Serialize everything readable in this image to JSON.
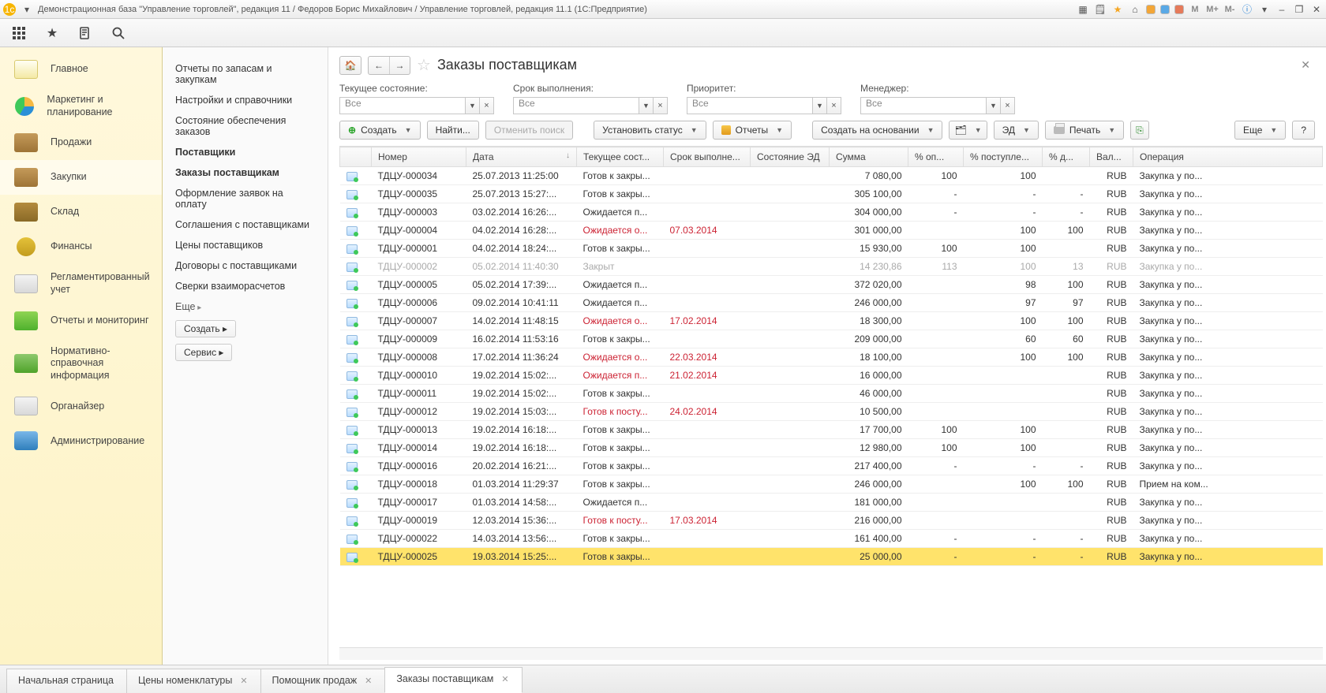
{
  "window_title": "Демонстрационная база \"Управление торговлей\", редакция 11 / Федоров Борис Михайлович / Управление торговлей, редакция 11.1  (1С:Предприятие)",
  "sidebar": [
    {
      "label": "Главное",
      "icon": "pi-main"
    },
    {
      "label": "Маркетинг и планирование",
      "icon": "pi-pie",
      "twoline": true
    },
    {
      "label": "Продажи",
      "icon": "pi-box"
    },
    {
      "label": "Закупки",
      "icon": "pi-cart",
      "active": true
    },
    {
      "label": "Склад",
      "icon": "pi-shelf"
    },
    {
      "label": "Финансы",
      "icon": "pi-coin"
    },
    {
      "label": "Регламентированный учет",
      "icon": "pi-doc"
    },
    {
      "label": "Отчеты и мониторинг",
      "icon": "pi-bars"
    },
    {
      "label": "Нормативно-справочная информация",
      "icon": "pi-ref",
      "twoline": true
    },
    {
      "label": "Органайзер",
      "icon": "pi-note"
    },
    {
      "label": "Администрирование",
      "icon": "pi-db"
    }
  ],
  "submenu": {
    "links": [
      {
        "label": "Отчеты по запасам и закупкам"
      },
      {
        "label": "Настройки и справочники"
      },
      {
        "label": "Состояние обеспечения заказов"
      },
      {
        "label": "Поставщики",
        "bold": true
      },
      {
        "label": "Заказы поставщикам",
        "bold": true
      },
      {
        "label": "Оформление заявок на оплату"
      },
      {
        "label": "Соглашения с поставщиками"
      },
      {
        "label": "Цены поставщиков"
      },
      {
        "label": "Договоры с поставщиками"
      },
      {
        "label": "Сверки взаиморасчетов"
      }
    ],
    "more": "Еще",
    "buttons": [
      "Создать",
      "Сервис"
    ]
  },
  "page": {
    "title": "Заказы поставщикам",
    "filters": [
      {
        "label": "Текущее состояние:",
        "value": "Все"
      },
      {
        "label": "Срок выполнения:",
        "value": "Все"
      },
      {
        "label": "Приоритет:",
        "value": "Все"
      },
      {
        "label": "Менеджер:",
        "value": "Все"
      }
    ],
    "toolbar": {
      "create": "Создать",
      "find": "Найти...",
      "cancel": "Отменить поиск",
      "set_status": "Установить статус",
      "reports": "Отчеты",
      "create_based": "Создать на основании",
      "ed": "ЭД",
      "print": "Печать",
      "more": "Еще",
      "help": "?"
    },
    "columns": [
      "",
      "Номер",
      "Дата",
      "Текущее сост...",
      "Срок выполне...",
      "Состояние ЭД",
      "Сумма",
      "% оп...",
      "% поступле...",
      "% д...",
      "Вал...",
      "Операция"
    ],
    "rows": [
      {
        "num": "ТДЦУ-000034",
        "date": "25.07.2013 11:25:00",
        "state": "Готов к закры...",
        "due": "",
        "sum": "7 080,00",
        "p1": "100",
        "p2": "100",
        "p3": "",
        "cur": "RUB",
        "op": "Закупка у по..."
      },
      {
        "num": "ТДЦУ-000035",
        "date": "25.07.2013 15:27:...",
        "state": "Готов к закры...",
        "due": "",
        "sum": "305 100,00",
        "p1": "-",
        "p2": "-",
        "p3": "-",
        "cur": "RUB",
        "op": "Закупка у по..."
      },
      {
        "num": "ТДЦУ-000003",
        "date": "03.02.2014 16:26:...",
        "state": "Ожидается п...",
        "due": "",
        "sum": "304 000,00",
        "p1": "-",
        "p2": "-",
        "p3": "-",
        "cur": "RUB",
        "op": "Закупка у по..."
      },
      {
        "num": "ТДЦУ-000004",
        "date": "04.02.2014 16:28:...",
        "state": "Ожидается о...",
        "state_red": true,
        "due": "07.03.2014",
        "due_red": true,
        "sum": "301 000,00",
        "p1": "",
        "p2": "100",
        "p3": "100",
        "cur": "RUB",
        "op": "Закупка у по..."
      },
      {
        "num": "ТДЦУ-000001",
        "date": "04.02.2014 18:24:...",
        "state": "Готов к закры...",
        "due": "",
        "sum": "15 930,00",
        "p1": "100",
        "p2": "100",
        "p3": "",
        "cur": "RUB",
        "op": "Закупка у по..."
      },
      {
        "num": "ТДЦУ-000002",
        "date": "05.02.2014 11:40:30",
        "state": "Закрыт",
        "due": "",
        "sum": "14 230,86",
        "p1": "113",
        "p2": "100",
        "p3": "13",
        "cur": "RUB",
        "op": "Закупка у по...",
        "closed": true
      },
      {
        "num": "ТДЦУ-000005",
        "date": "05.02.2014 17:39:...",
        "state": "Ожидается п...",
        "due": "",
        "sum": "372 020,00",
        "p1": "",
        "p2": "98",
        "p3": "100",
        "cur": "RUB",
        "op": "Закупка у по..."
      },
      {
        "num": "ТДЦУ-000006",
        "date": "09.02.2014 10:41:11",
        "state": "Ожидается п...",
        "due": "",
        "sum": "246 000,00",
        "p1": "",
        "p2": "97",
        "p3": "97",
        "cur": "RUB",
        "op": "Закупка у по..."
      },
      {
        "num": "ТДЦУ-000007",
        "date": "14.02.2014 11:48:15",
        "state": "Ожидается о...",
        "state_red": true,
        "due": "17.02.2014",
        "due_red": true,
        "sum": "18 300,00",
        "p1": "",
        "p2": "100",
        "p3": "100",
        "cur": "RUB",
        "op": "Закупка у по..."
      },
      {
        "num": "ТДЦУ-000009",
        "date": "16.02.2014 11:53:16",
        "state": "Готов к закры...",
        "due": "",
        "sum": "209 000,00",
        "p1": "",
        "p2": "60",
        "p3": "60",
        "cur": "RUB",
        "op": "Закупка у по..."
      },
      {
        "num": "ТДЦУ-000008",
        "date": "17.02.2014 11:36:24",
        "state": "Ожидается о...",
        "state_red": true,
        "due": "22.03.2014",
        "due_red": true,
        "sum": "18 100,00",
        "p1": "",
        "p2": "100",
        "p3": "100",
        "cur": "RUB",
        "op": "Закупка у по..."
      },
      {
        "num": "ТДЦУ-000010",
        "date": "19.02.2014 15:02:...",
        "state": "Ожидается п...",
        "state_red": true,
        "due": "21.02.2014",
        "due_red": true,
        "sum": "16 000,00",
        "p1": "",
        "p2": "",
        "p3": "",
        "cur": "RUB",
        "op": "Закупка у по..."
      },
      {
        "num": "ТДЦУ-000011",
        "date": "19.02.2014 15:02:...",
        "state": "Готов к закры...",
        "due": "",
        "sum": "46 000,00",
        "p1": "",
        "p2": "",
        "p3": "",
        "cur": "RUB",
        "op": "Закупка у по..."
      },
      {
        "num": "ТДЦУ-000012",
        "date": "19.02.2014 15:03:...",
        "state": "Готов к посту...",
        "state_red": true,
        "due": "24.02.2014",
        "due_red": true,
        "sum": "10 500,00",
        "p1": "",
        "p2": "",
        "p3": "",
        "cur": "RUB",
        "op": "Закупка у по..."
      },
      {
        "num": "ТДЦУ-000013",
        "date": "19.02.2014 16:18:...",
        "state": "Готов к закры...",
        "due": "",
        "sum": "17 700,00",
        "p1": "100",
        "p2": "100",
        "p3": "",
        "cur": "RUB",
        "op": "Закупка у по..."
      },
      {
        "num": "ТДЦУ-000014",
        "date": "19.02.2014 16:18:...",
        "state": "Готов к закры...",
        "due": "",
        "sum": "12 980,00",
        "p1": "100",
        "p2": "100",
        "p3": "",
        "cur": "RUB",
        "op": "Закупка у по..."
      },
      {
        "num": "ТДЦУ-000016",
        "date": "20.02.2014 16:21:...",
        "state": "Готов к закры...",
        "due": "",
        "sum": "217 400,00",
        "p1": "-",
        "p2": "-",
        "p3": "-",
        "cur": "RUB",
        "op": "Закупка у по..."
      },
      {
        "num": "ТДЦУ-000018",
        "date": "01.03.2014 11:29:37",
        "state": "Готов к закры...",
        "due": "",
        "sum": "246 000,00",
        "p1": "",
        "p2": "100",
        "p3": "100",
        "cur": "RUB",
        "op": "Прием на ком..."
      },
      {
        "num": "ТДЦУ-000017",
        "date": "01.03.2014 14:58:...",
        "state": "Ожидается п...",
        "due": "",
        "sum": "181 000,00",
        "p1": "",
        "p2": "",
        "p3": "",
        "cur": "RUB",
        "op": "Закупка у по..."
      },
      {
        "num": "ТДЦУ-000019",
        "date": "12.03.2014 15:36:...",
        "state": "Готов к посту...",
        "state_red": true,
        "due": "17.03.2014",
        "due_red": true,
        "sum": "216 000,00",
        "p1": "",
        "p2": "",
        "p3": "",
        "cur": "RUB",
        "op": "Закупка у по..."
      },
      {
        "num": "ТДЦУ-000022",
        "date": "14.03.2014 13:56:...",
        "state": "Готов к закры...",
        "due": "",
        "sum": "161 400,00",
        "p1": "-",
        "p2": "-",
        "p3": "-",
        "cur": "RUB",
        "op": "Закупка у по..."
      },
      {
        "num": "ТДЦУ-000025",
        "date": "19.03.2014 15:25:...",
        "state": "Готов к закры...",
        "due": "",
        "sum": "25 000,00",
        "p1": "-",
        "p2": "-",
        "p3": "-",
        "cur": "RUB",
        "op": "Закупка у по...",
        "selected": true
      }
    ]
  },
  "bottom_tabs": [
    {
      "label": "Начальная страница",
      "closable": false
    },
    {
      "label": "Цены номенклатуры",
      "closable": true
    },
    {
      "label": "Помощник продаж",
      "closable": true
    },
    {
      "label": "Заказы поставщикам",
      "closable": true,
      "active": true
    }
  ]
}
